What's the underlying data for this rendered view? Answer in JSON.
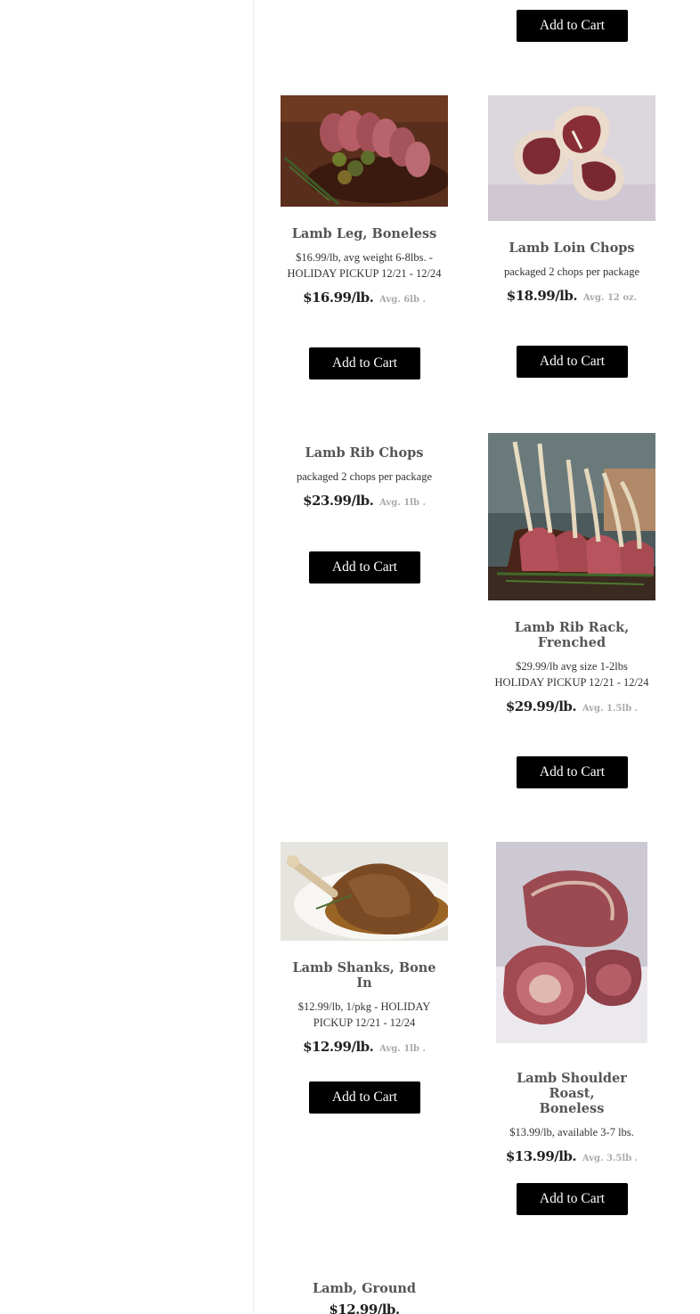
{
  "cart_button_label": "Add to Cart",
  "products": [
    {
      "name": "Lamb Leg, Boneless",
      "desc_line1": "$16.99/lb, avg weight 6-8lbs. -",
      "desc_line2": "HOLIDAY PICKUP 12/21 - 12/24",
      "price": "$16.99/lb.",
      "avg": "Avg. 6lb ."
    },
    {
      "name": "Lamb Loin Chops",
      "desc_line1": "packaged 2 chops per package",
      "desc_line2": "",
      "price": "$18.99/lb.",
      "avg": "Avg. 12 oz."
    },
    {
      "name": "Lamb Rib Chops",
      "desc_line1": "packaged 2 chops per package",
      "desc_line2": "",
      "price": "$23.99/lb.",
      "avg": "Avg. 1lb ."
    },
    {
      "name_line1": "Lamb Rib Rack,",
      "name_line2": "Frenched",
      "desc_line1": "$29.99/lb avg size 1-2lbs",
      "desc_line2": "HOLIDAY PICKUP 12/21 - 12/24",
      "price": "$29.99/lb.",
      "avg": "Avg. 1.5lb ."
    },
    {
      "name": "Lamb Shanks, Bone In",
      "desc_line1": "$12.99/lb, 1/pkg - HOLIDAY",
      "desc_line2": "PICKUP 12/21 - 12/24",
      "price": "$12.99/lb.",
      "avg": "Avg. 1lb ."
    },
    {
      "name_line1": "Lamb Shoulder Roast,",
      "name_line2": "Boneless",
      "desc_line1": "$13.99/lb, available 3-7 lbs.",
      "desc_line2": "",
      "price": "$13.99/lb.",
      "avg": "Avg. 3.5lb ."
    },
    {
      "name": "Lamb, Ground",
      "price": "$12.99/lb."
    }
  ],
  "icons": {
    "lamb_leg": "sliced-lamb-leg-photo",
    "loin_chops": "raw-loin-chops-photo",
    "rib_rack": "frenched-rib-rack-photo",
    "shanks": "braised-shank-photo",
    "shoulder": "raw-shoulder-roast-photo"
  }
}
